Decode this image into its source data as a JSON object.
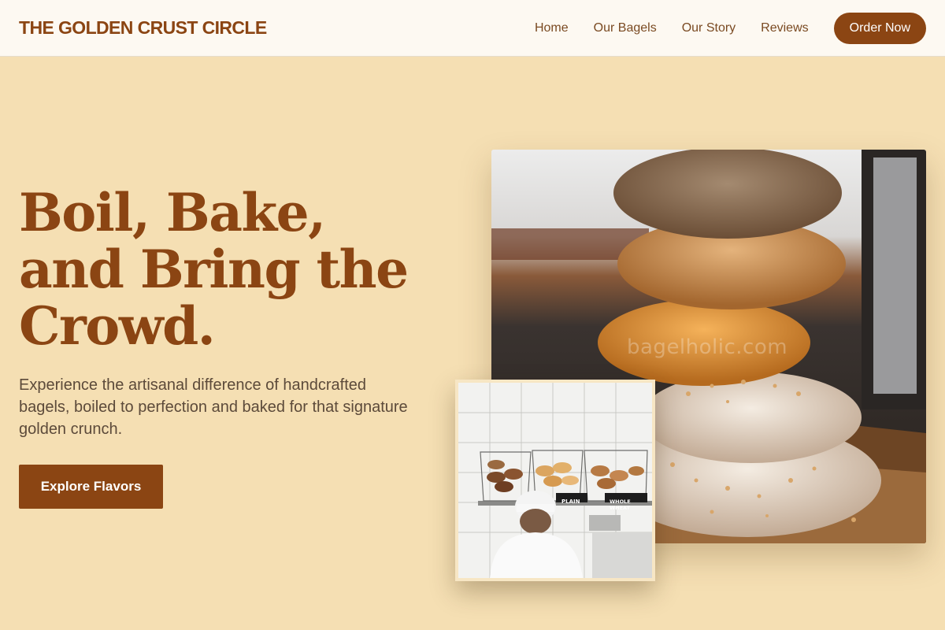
{
  "header": {
    "brand": "THE GOLDEN CRUST CIRCLE",
    "nav": [
      "Home",
      "Our Bagels",
      "Our Story",
      "Reviews"
    ],
    "cta": "Order Now"
  },
  "hero": {
    "title": "Boil, Bake, and Bring the Crowd.",
    "subtitle": "Experience the artisanal difference of handcrafted bagels, boiled to perfection and baked for that signature golden crunch.",
    "cta": "Explore Flavors"
  },
  "images": {
    "main_watermark": "bagelholic.com",
    "inset_labels": [
      "PLAIN",
      "WHOLE WHEAT"
    ]
  },
  "colors": {
    "accent": "#8b4513",
    "background": "#f5dfb3",
    "header_bg": "#fdf9f2",
    "body_text": "#5c4a3a"
  }
}
